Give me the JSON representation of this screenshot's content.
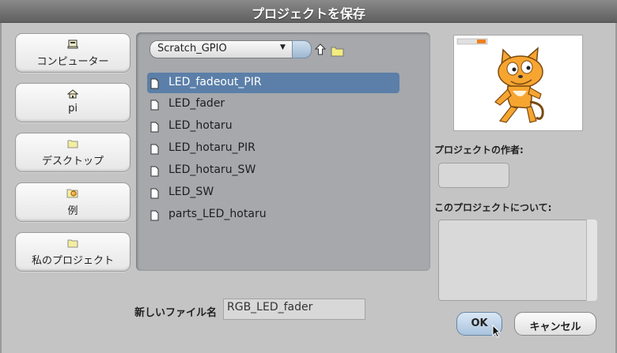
{
  "dialog": {
    "title": "プロジェクトを保存"
  },
  "shortcuts": [
    {
      "label": "コンピューター",
      "icon": "computer-icon"
    },
    {
      "label": "pi",
      "icon": "home-icon"
    },
    {
      "label": "デスクトップ",
      "icon": "folder-icon"
    },
    {
      "label": "例",
      "icon": "examples-icon"
    },
    {
      "label": "私のプロジェクト",
      "icon": "folder-icon"
    }
  ],
  "browser": {
    "current_folder": "Scratch_GPIO",
    "files": [
      {
        "name": "LED_fadeout_PIR",
        "selected": true
      },
      {
        "name": "LED_fader",
        "selected": false
      },
      {
        "name": "LED_hotaru",
        "selected": false
      },
      {
        "name": "LED_hotaru_PIR",
        "selected": false
      },
      {
        "name": "LED_hotaru_SW",
        "selected": false
      },
      {
        "name": "LED_SW",
        "selected": false
      },
      {
        "name": "parts_LED_hotaru",
        "selected": false
      }
    ]
  },
  "filename": {
    "label": "新しいファイル名",
    "value": "RGB_LED_fader"
  },
  "project_info": {
    "author_label": "プロジェクトの作者:",
    "author_value": "",
    "notes_label": "このプロジェクトについて:",
    "notes_value": ""
  },
  "buttons": {
    "ok": "OK",
    "cancel": "キャンセル"
  },
  "colors": {
    "selection": "#5b7fa8",
    "dialog_bg": "#c4c4c4",
    "file_pane_bg": "#a6a8ab",
    "scratch_cat": "#f7a531"
  }
}
